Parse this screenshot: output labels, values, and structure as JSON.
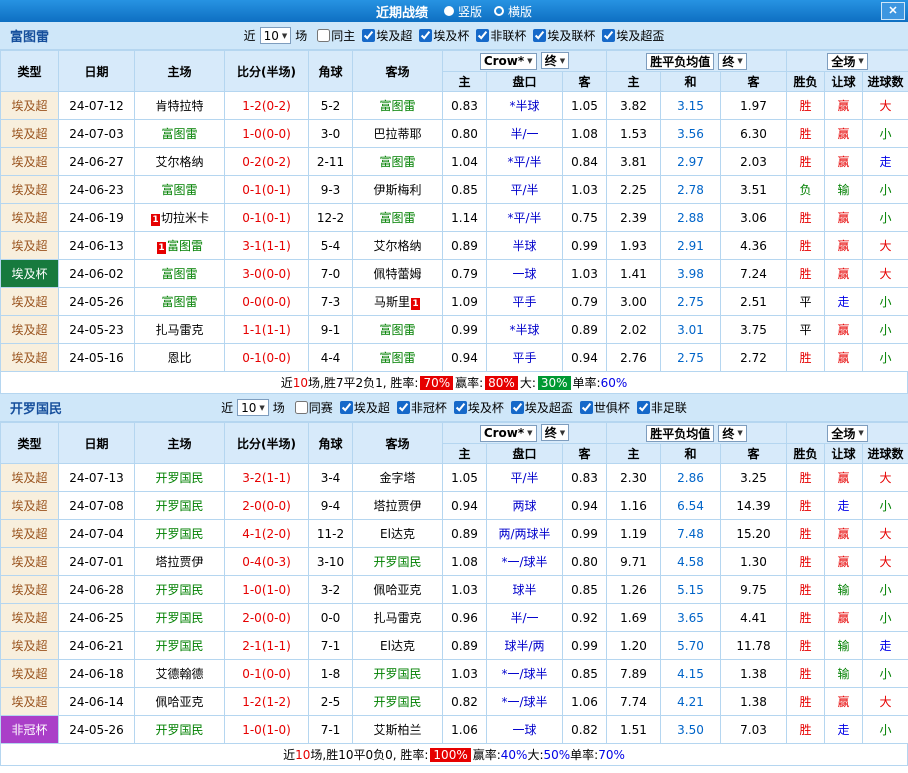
{
  "titlebar": {
    "title": "近期战绩",
    "radios": [
      {
        "label": "竖版",
        "selected": true
      },
      {
        "label": "横版",
        "selected": false
      }
    ],
    "close_label": "✕"
  },
  "controls": {
    "near_prefix": "近",
    "near_suffix": "场",
    "crow": "Crow*",
    "final": "终",
    "avg": "胜平负均值",
    "field": "全场"
  },
  "thead": {
    "type": "类型",
    "date": "日期",
    "home": "主场",
    "score": "比分(半场)",
    "corner": "角球",
    "away": "客场",
    "h_home": "主",
    "h_hc": "盘口",
    "h_away": "客",
    "a_home": "主",
    "a_draw": "和",
    "a_away": "客",
    "r_result": "胜负",
    "r_asian": "让球",
    "r_goals": "进球数"
  },
  "colors": {
    "topbar_blue": "#1377CC",
    "panel_blue": "#CFE7F9",
    "team_green": "#008000",
    "score_red": "#E60000",
    "handicap_blue": "#0000CC",
    "league_beige": "#F8EFDD",
    "cup_green": "#177A3E",
    "afc_purple": "#AA3FC8"
  },
  "sections": [
    {
      "team": "富图雷",
      "near_value": "10",
      "filters": [
        {
          "label": "同主",
          "checked": false
        },
        {
          "label": "埃及超",
          "checked": true
        },
        {
          "label": "埃及杯",
          "checked": true
        },
        {
          "label": "非联杯",
          "checked": true
        },
        {
          "label": "埃及联杯",
          "checked": true
        },
        {
          "label": "埃及超盃",
          "checked": true
        }
      ],
      "rows": [
        {
          "type": "埃及超",
          "date": "24-07-12",
          "home": {
            "name": "肯特拉特",
            "focus": false,
            "badge": ""
          },
          "score": "1-2(0-2)",
          "corner": "5-2",
          "away": {
            "name": "富图雷",
            "focus": true,
            "badge": ""
          },
          "odds": [
            "0.83",
            "*半球",
            "1.05"
          ],
          "avg": [
            "3.82",
            "3.15",
            "1.97"
          ],
          "res": [
            "胜",
            "赢",
            "大"
          ]
        },
        {
          "type": "埃及超",
          "date": "24-07-03",
          "home": {
            "name": "富图雷",
            "focus": true,
            "badge": ""
          },
          "score": "1-0(0-0)",
          "corner": "3-0",
          "away": {
            "name": "巴拉蒂耶",
            "focus": false,
            "badge": ""
          },
          "odds": [
            "0.80",
            "半/一",
            "1.08"
          ],
          "avg": [
            "1.53",
            "3.56",
            "6.30"
          ],
          "res": [
            "胜",
            "赢",
            "小"
          ]
        },
        {
          "type": "埃及超",
          "date": "24-06-27",
          "home": {
            "name": "艾尔格纳",
            "focus": false,
            "badge": ""
          },
          "score": "0-2(0-2)",
          "corner": "2-11",
          "away": {
            "name": "富图雷",
            "focus": true,
            "badge": ""
          },
          "odds": [
            "1.04",
            "*平/半",
            "0.84"
          ],
          "avg": [
            "3.81",
            "2.97",
            "2.03"
          ],
          "res": [
            "胜",
            "赢",
            "走"
          ]
        },
        {
          "type": "埃及超",
          "date": "24-06-23",
          "home": {
            "name": "富图雷",
            "focus": true,
            "badge": ""
          },
          "score": "0-1(0-1)",
          "corner": "9-3",
          "away": {
            "name": "伊斯梅利",
            "focus": false,
            "badge": ""
          },
          "odds": [
            "0.85",
            "平/半",
            "1.03"
          ],
          "avg": [
            "2.25",
            "2.78",
            "3.51"
          ],
          "res": [
            "负",
            "输",
            "小"
          ]
        },
        {
          "type": "埃及超",
          "date": "24-06-19",
          "home": {
            "name": "切拉米卡",
            "focus": false,
            "badge": "1",
            "badge_pos": "before"
          },
          "score": "0-1(0-1)",
          "corner": "12-2",
          "away": {
            "name": "富图雷",
            "focus": true,
            "badge": ""
          },
          "odds": [
            "1.14",
            "*平/半",
            "0.75"
          ],
          "avg": [
            "2.39",
            "2.88",
            "3.06"
          ],
          "res": [
            "胜",
            "赢",
            "小"
          ]
        },
        {
          "type": "埃及超",
          "date": "24-06-13",
          "home": {
            "name": "富图雷",
            "focus": true,
            "badge": "1",
            "badge_pos": "before"
          },
          "score": "3-1(1-1)",
          "corner": "5-4",
          "away": {
            "name": "艾尔格纳",
            "focus": false,
            "badge": ""
          },
          "odds": [
            "0.89",
            "半球",
            "0.99"
          ],
          "avg": [
            "1.93",
            "2.91",
            "4.36"
          ],
          "res": [
            "胜",
            "赢",
            "大"
          ]
        },
        {
          "type": "埃及杯",
          "date": "24-06-02",
          "home": {
            "name": "富图雷",
            "focus": true,
            "badge": ""
          },
          "score": "3-0(0-0)",
          "corner": "7-0",
          "away": {
            "name": "佩特蕾姆",
            "focus": false,
            "badge": ""
          },
          "odds": [
            "0.79",
            "一球",
            "1.03"
          ],
          "avg": [
            "1.41",
            "3.98",
            "7.24"
          ],
          "res": [
            "胜",
            "赢",
            "大"
          ]
        },
        {
          "type": "埃及超",
          "date": "24-05-26",
          "home": {
            "name": "富图雷",
            "focus": true,
            "badge": ""
          },
          "score": "0-0(0-0)",
          "corner": "7-3",
          "away": {
            "name": "马斯里",
            "focus": false,
            "badge": "1",
            "badge_pos": "after"
          },
          "odds": [
            "1.09",
            "平手",
            "0.79"
          ],
          "avg": [
            "3.00",
            "2.75",
            "2.51"
          ],
          "res": [
            "平",
            "走",
            "小"
          ]
        },
        {
          "type": "埃及超",
          "date": "24-05-23",
          "home": {
            "name": "扎马雷克",
            "focus": false,
            "badge": ""
          },
          "score": "1-1(1-1)",
          "corner": "9-1",
          "away": {
            "name": "富图雷",
            "focus": true,
            "badge": ""
          },
          "odds": [
            "0.99",
            "*半球",
            "0.89"
          ],
          "avg": [
            "2.02",
            "3.01",
            "3.75"
          ],
          "res": [
            "平",
            "赢",
            "小"
          ]
        },
        {
          "type": "埃及超",
          "date": "24-05-16",
          "home": {
            "name": "恩比",
            "focus": false,
            "badge": ""
          },
          "score": "0-1(0-0)",
          "corner": "4-4",
          "away": {
            "name": "富图雷",
            "focus": true,
            "badge": ""
          },
          "odds": [
            "0.94",
            "平手",
            "0.94"
          ],
          "avg": [
            "2.76",
            "2.75",
            "2.72"
          ],
          "res": [
            "胜",
            "赢",
            "小"
          ]
        }
      ],
      "summary": [
        {
          "t": "近"
        },
        {
          "t": "10",
          "c": "red"
        },
        {
          "t": "场,胜7平2负1, 胜率: "
        },
        {
          "t": "70%",
          "bg": "red"
        },
        {
          "t": " 赢率: "
        },
        {
          "t": "80%",
          "bg": "red"
        },
        {
          "t": " 大: "
        },
        {
          "t": "30%",
          "bg": "green"
        },
        {
          "t": " 单率:"
        },
        {
          "t": "60%",
          "c": "blue"
        }
      ]
    },
    {
      "team": "开罗国民",
      "near_value": "10",
      "filters": [
        {
          "label": "同赛",
          "checked": false
        },
        {
          "label": "埃及超",
          "checked": true
        },
        {
          "label": "非冠杯",
          "checked": true
        },
        {
          "label": "埃及杯",
          "checked": true
        },
        {
          "label": "埃及超盃",
          "checked": true
        },
        {
          "label": "世俱杯",
          "checked": true
        },
        {
          "label": "非足联",
          "checked": true
        }
      ],
      "rows": [
        {
          "type": "埃及超",
          "date": "24-07-13",
          "home": {
            "name": "开罗国民",
            "focus": true,
            "badge": ""
          },
          "score": "3-2(1-1)",
          "corner": "3-4",
          "away": {
            "name": "金字塔",
            "focus": false,
            "badge": ""
          },
          "odds": [
            "1.05",
            "平/半",
            "0.83"
          ],
          "avg": [
            "2.30",
            "2.86",
            "3.25"
          ],
          "res": [
            "胜",
            "赢",
            "大"
          ]
        },
        {
          "type": "埃及超",
          "date": "24-07-08",
          "home": {
            "name": "开罗国民",
            "focus": true,
            "badge": ""
          },
          "score": "2-0(0-0)",
          "corner": "9-4",
          "away": {
            "name": "塔拉贾伊",
            "focus": false,
            "badge": ""
          },
          "odds": [
            "0.94",
            "两球",
            "0.94"
          ],
          "avg": [
            "1.16",
            "6.54",
            "14.39"
          ],
          "res": [
            "胜",
            "走",
            "小"
          ]
        },
        {
          "type": "埃及超",
          "date": "24-07-04",
          "home": {
            "name": "开罗国民",
            "focus": true,
            "badge": ""
          },
          "score": "4-1(2-0)",
          "corner": "11-2",
          "away": {
            "name": "El达克",
            "focus": false,
            "badge": ""
          },
          "odds": [
            "0.89",
            "两/两球半",
            "0.99"
          ],
          "avg": [
            "1.19",
            "7.48",
            "15.20"
          ],
          "res": [
            "胜",
            "赢",
            "大"
          ]
        },
        {
          "type": "埃及超",
          "date": "24-07-01",
          "home": {
            "name": "塔拉贾伊",
            "focus": false,
            "badge": ""
          },
          "score": "0-4(0-3)",
          "corner": "3-10",
          "away": {
            "name": "开罗国民",
            "focus": true,
            "badge": ""
          },
          "odds": [
            "1.08",
            "*一/球半",
            "0.80"
          ],
          "avg": [
            "9.71",
            "4.58",
            "1.30"
          ],
          "res": [
            "胜",
            "赢",
            "大"
          ]
        },
        {
          "type": "埃及超",
          "date": "24-06-28",
          "home": {
            "name": "开罗国民",
            "focus": true,
            "badge": ""
          },
          "score": "1-0(1-0)",
          "corner": "3-2",
          "away": {
            "name": "佩哈亚克",
            "focus": false,
            "badge": ""
          },
          "odds": [
            "1.03",
            "球半",
            "0.85"
          ],
          "avg": [
            "1.26",
            "5.15",
            "9.75"
          ],
          "res": [
            "胜",
            "输",
            "小"
          ]
        },
        {
          "type": "埃及超",
          "date": "24-06-25",
          "home": {
            "name": "开罗国民",
            "focus": true,
            "badge": ""
          },
          "score": "2-0(0-0)",
          "corner": "0-0",
          "away": {
            "name": "扎马雷克",
            "focus": false,
            "badge": ""
          },
          "odds": [
            "0.96",
            "半/一",
            "0.92"
          ],
          "avg": [
            "1.69",
            "3.65",
            "4.41"
          ],
          "res": [
            "胜",
            "赢",
            "小"
          ]
        },
        {
          "type": "埃及超",
          "date": "24-06-21",
          "home": {
            "name": "开罗国民",
            "focus": true,
            "badge": ""
          },
          "score": "2-1(1-1)",
          "corner": "7-1",
          "away": {
            "name": "El达克",
            "focus": false,
            "badge": ""
          },
          "odds": [
            "0.89",
            "球半/两",
            "0.99"
          ],
          "avg": [
            "1.20",
            "5.70",
            "11.78"
          ],
          "res": [
            "胜",
            "输",
            "走"
          ]
        },
        {
          "type": "埃及超",
          "date": "24-06-18",
          "home": {
            "name": "艾德翰德",
            "focus": false,
            "badge": ""
          },
          "score": "0-1(0-0)",
          "corner": "1-8",
          "away": {
            "name": "开罗国民",
            "focus": true,
            "badge": ""
          },
          "odds": [
            "1.03",
            "*一/球半",
            "0.85"
          ],
          "avg": [
            "7.89",
            "4.15",
            "1.38"
          ],
          "res": [
            "胜",
            "输",
            "小"
          ]
        },
        {
          "type": "埃及超",
          "date": "24-06-14",
          "home": {
            "name": "佩哈亚克",
            "focus": false,
            "badge": ""
          },
          "score": "1-2(1-2)",
          "corner": "2-5",
          "away": {
            "name": "开罗国民",
            "focus": true,
            "badge": ""
          },
          "odds": [
            "0.82",
            "*一/球半",
            "1.06"
          ],
          "avg": [
            "7.74",
            "4.21",
            "1.38"
          ],
          "res": [
            "胜",
            "赢",
            "大"
          ]
        },
        {
          "type": "非冠杯",
          "date": "24-05-26",
          "home": {
            "name": "开罗国民",
            "focus": true,
            "badge": ""
          },
          "score": "1-0(1-0)",
          "corner": "7-1",
          "away": {
            "name": "艾斯柏兰",
            "focus": false,
            "badge": ""
          },
          "odds": [
            "1.06",
            "一球",
            "0.82"
          ],
          "avg": [
            "1.51",
            "3.50",
            "7.03"
          ],
          "res": [
            "胜",
            "走",
            "小"
          ]
        }
      ],
      "summary": [
        {
          "t": "近"
        },
        {
          "t": "10",
          "c": "red"
        },
        {
          "t": "场,胜10平0负0, 胜率: "
        },
        {
          "t": "100%",
          "bg": "red"
        },
        {
          "t": " 赢率:"
        },
        {
          "t": "40%",
          "c": "blue"
        },
        {
          "t": " 大:"
        },
        {
          "t": "50%",
          "c": "blue"
        },
        {
          "t": " 单率:"
        },
        {
          "t": "70%",
          "c": "blue"
        }
      ]
    }
  ]
}
